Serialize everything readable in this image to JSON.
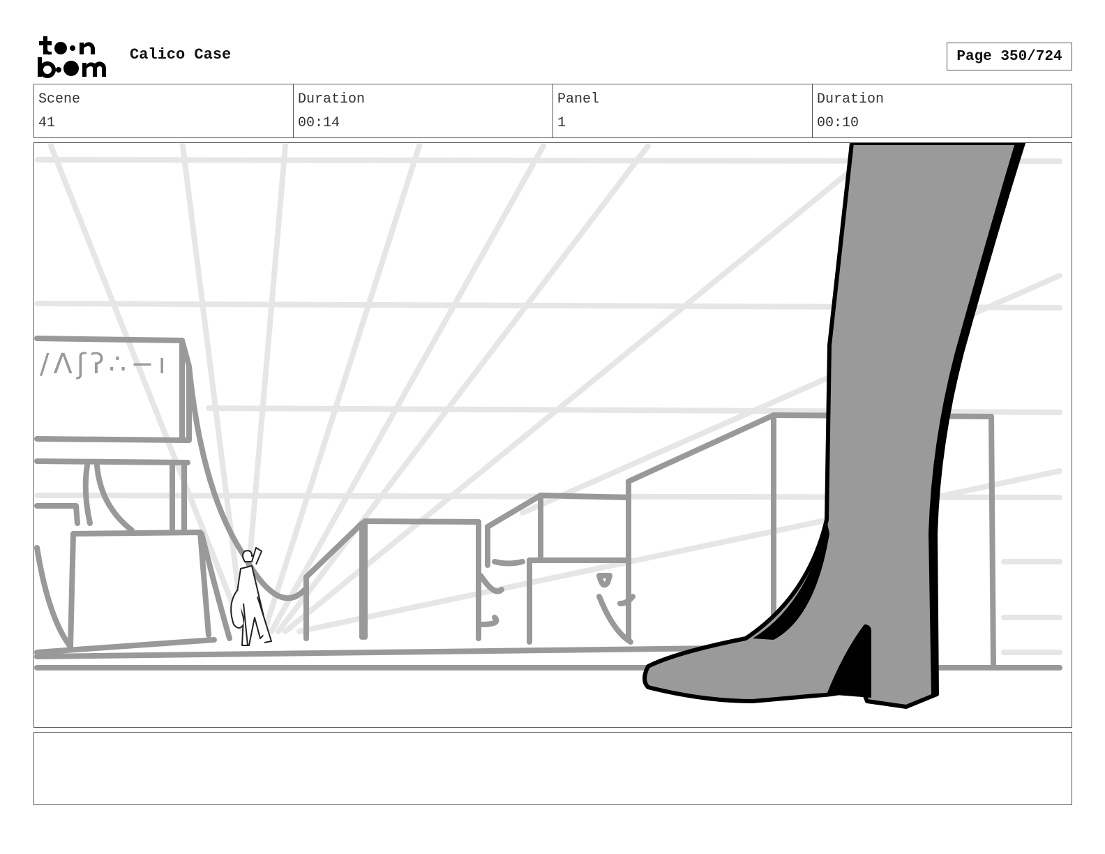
{
  "header": {
    "logo_text": "toon boom",
    "project_title": "Calico Case",
    "page_label": "Page 350/724"
  },
  "info": {
    "scene_label": "Scene",
    "scene_value": "41",
    "scene_duration_label": "Duration",
    "scene_duration_value": "00:14",
    "panel_label": "Panel",
    "panel_value": "1",
    "panel_duration_label": "Duration",
    "panel_duration_value": "00:10"
  },
  "panel": {
    "description": "",
    "sign_glyphs": "∕Λʃʔ∴−ı"
  },
  "notes": {
    "text": ""
  },
  "colors": {
    "sketch_gray": "#999999",
    "guide_gray": "#e6e6e6",
    "boot_fill": "#9a9a9a",
    "outline_black": "#000000"
  }
}
